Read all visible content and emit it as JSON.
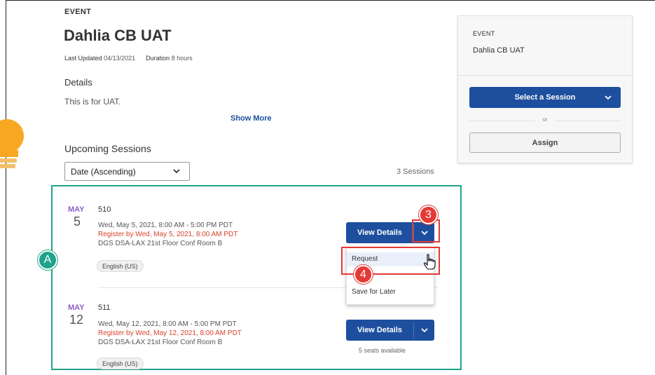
{
  "event": {
    "eyebrow": "EVENT",
    "title": "Dahlia CB UAT",
    "last_updated_label": "Last Updated",
    "last_updated_value": "04/13/2021",
    "duration_label": "Duration",
    "duration_value": "8 hours",
    "details_heading": "Details",
    "description": "This is for UAT.",
    "show_more": "Show More"
  },
  "sessions_section": {
    "heading": "Upcoming Sessions",
    "sort_value": "Date (Ascending)",
    "count": "3 Sessions",
    "items": [
      {
        "month": "MAY",
        "day": "5",
        "name": "510",
        "time": "Wed, May 5, 2021, 8:00 AM - 5:00 PM PDT",
        "register_by": "Register by Wed, May 5, 2021, 8:00 AM PDT",
        "location": "DGS DSA-LAX  21st Floor Conf Room B",
        "language": "English (US)",
        "button": "View Details"
      },
      {
        "month": "MAY",
        "day": "12",
        "name": "511",
        "time": "Wed, May 12, 2021, 8:00 AM - 5:00 PM PDT",
        "register_by": "Register by Wed, May 12, 2021, 8:00 AM PDT",
        "location": "DGS DSA-LAX  21st Floor Conf Room B",
        "language": "English (US)",
        "button": "View Details",
        "seats": "5 seats available"
      }
    ]
  },
  "dropdown_menu": {
    "items": [
      "Request",
      "Save for Later"
    ]
  },
  "sidebar": {
    "eyebrow": "EVENT",
    "title": "Dahlia CB UAT",
    "select_session": "Select a Session",
    "or": "or",
    "assign": "Assign"
  },
  "annotations": {
    "badge_a": "A",
    "badge_3": "3",
    "badge_4": "4",
    "colors": {
      "teal": "#1fa38a",
      "red": "#e53935",
      "blue": "#1d4f9e",
      "purple": "#8e5fc8",
      "orange": "#f7a823"
    }
  },
  "icons": [
    "lightbulb-icon",
    "chevron-down-icon",
    "hand-cursor-icon"
  ]
}
